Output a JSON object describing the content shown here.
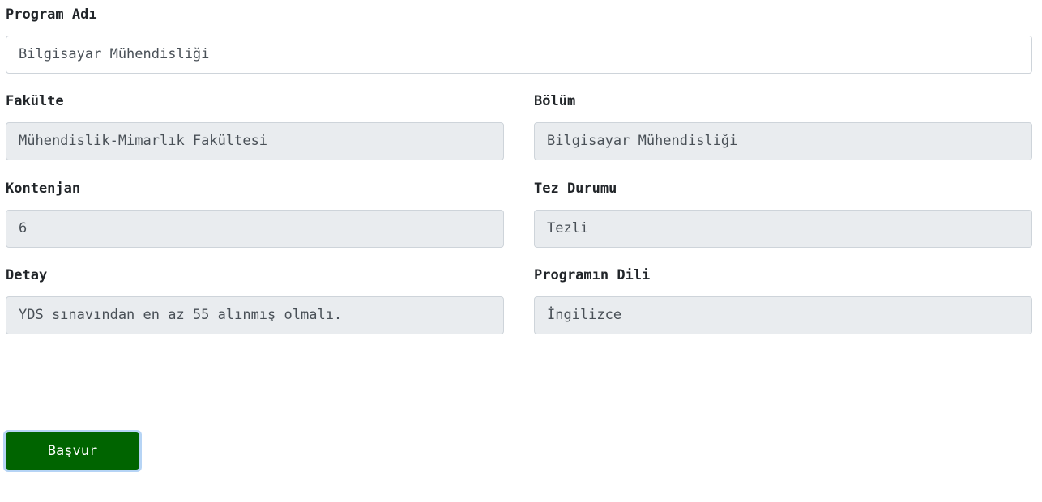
{
  "form": {
    "program_name": {
      "label": "Program Adı",
      "value": "Bilgisayar Mühendisliği"
    },
    "faculty": {
      "label": "Fakülte",
      "value": "Mühendislik-Mimarlık Fakültesi"
    },
    "department": {
      "label": "Bölüm",
      "value": "Bilgisayar Mühendisliği"
    },
    "quota": {
      "label": "Kontenjan",
      "value": "6"
    },
    "thesis_status": {
      "label": "Tez Durumu",
      "value": "Tezli"
    },
    "detail": {
      "label": "Detay",
      "value": "YDS sınavından en az 55 alınmış olmalı."
    },
    "program_language": {
      "label": "Programın Dili",
      "value": "İngilizce"
    }
  },
  "actions": {
    "apply_label": "Başvur"
  }
}
